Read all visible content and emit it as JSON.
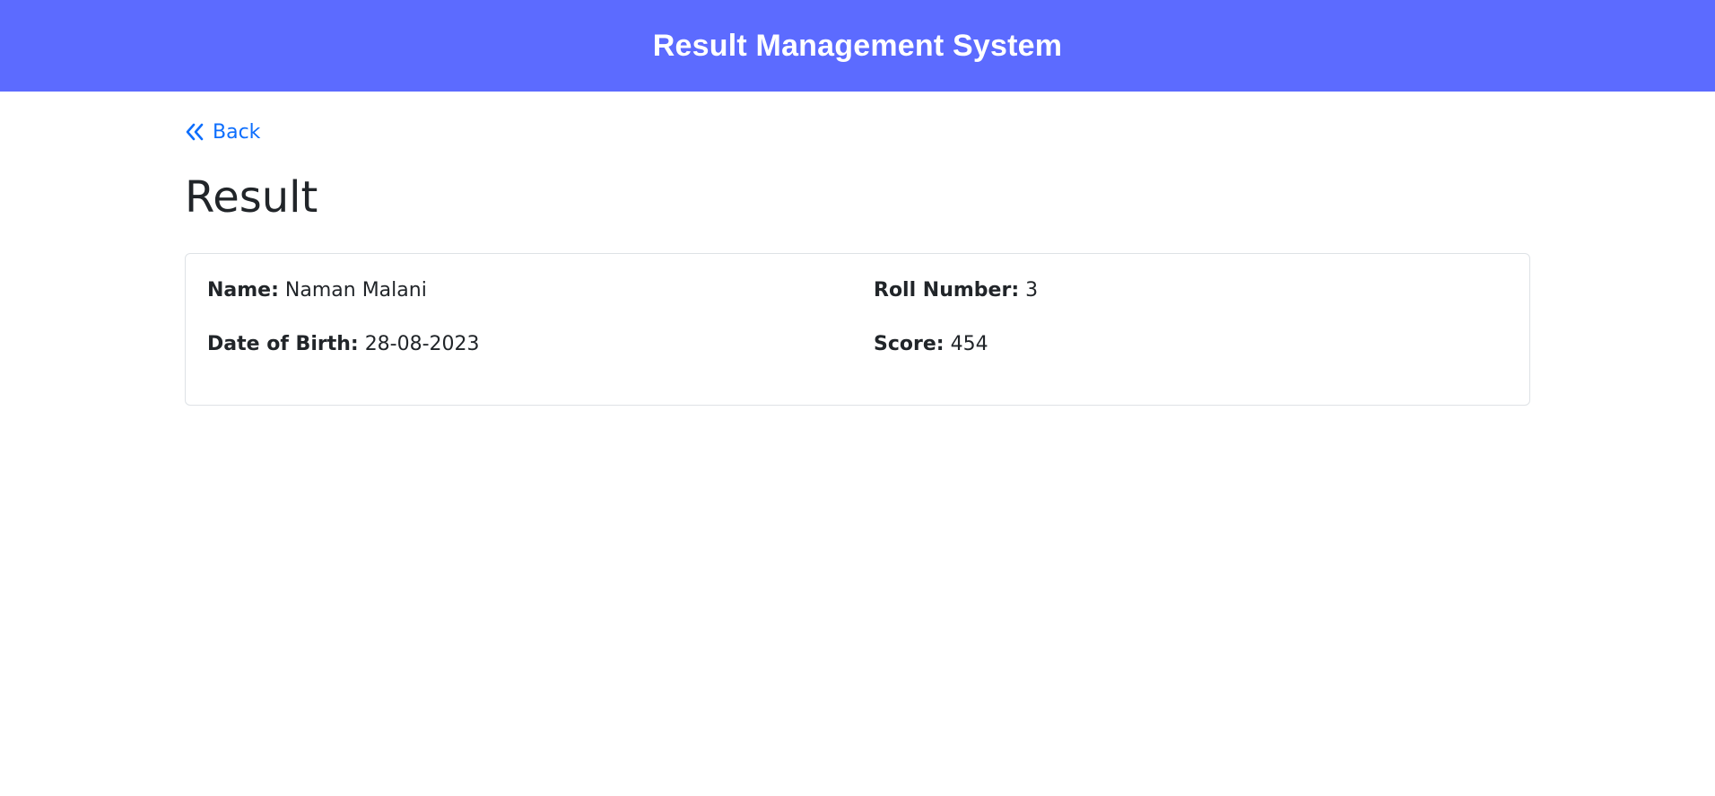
{
  "header": {
    "title": "Result Management System",
    "background_color": "#5c6bff"
  },
  "nav": {
    "back_label": "Back",
    "back_icon": "double-chevron-left-icon",
    "link_color": "#0d6efd"
  },
  "page": {
    "title": "Result"
  },
  "result": {
    "name_label": "Name:",
    "name_value": "Naman Malani",
    "roll_label": "Roll Number:",
    "roll_value": "3",
    "dob_label": "Date of Birth:",
    "dob_value": "28-08-2023",
    "score_label": "Score:",
    "score_value": "454"
  }
}
